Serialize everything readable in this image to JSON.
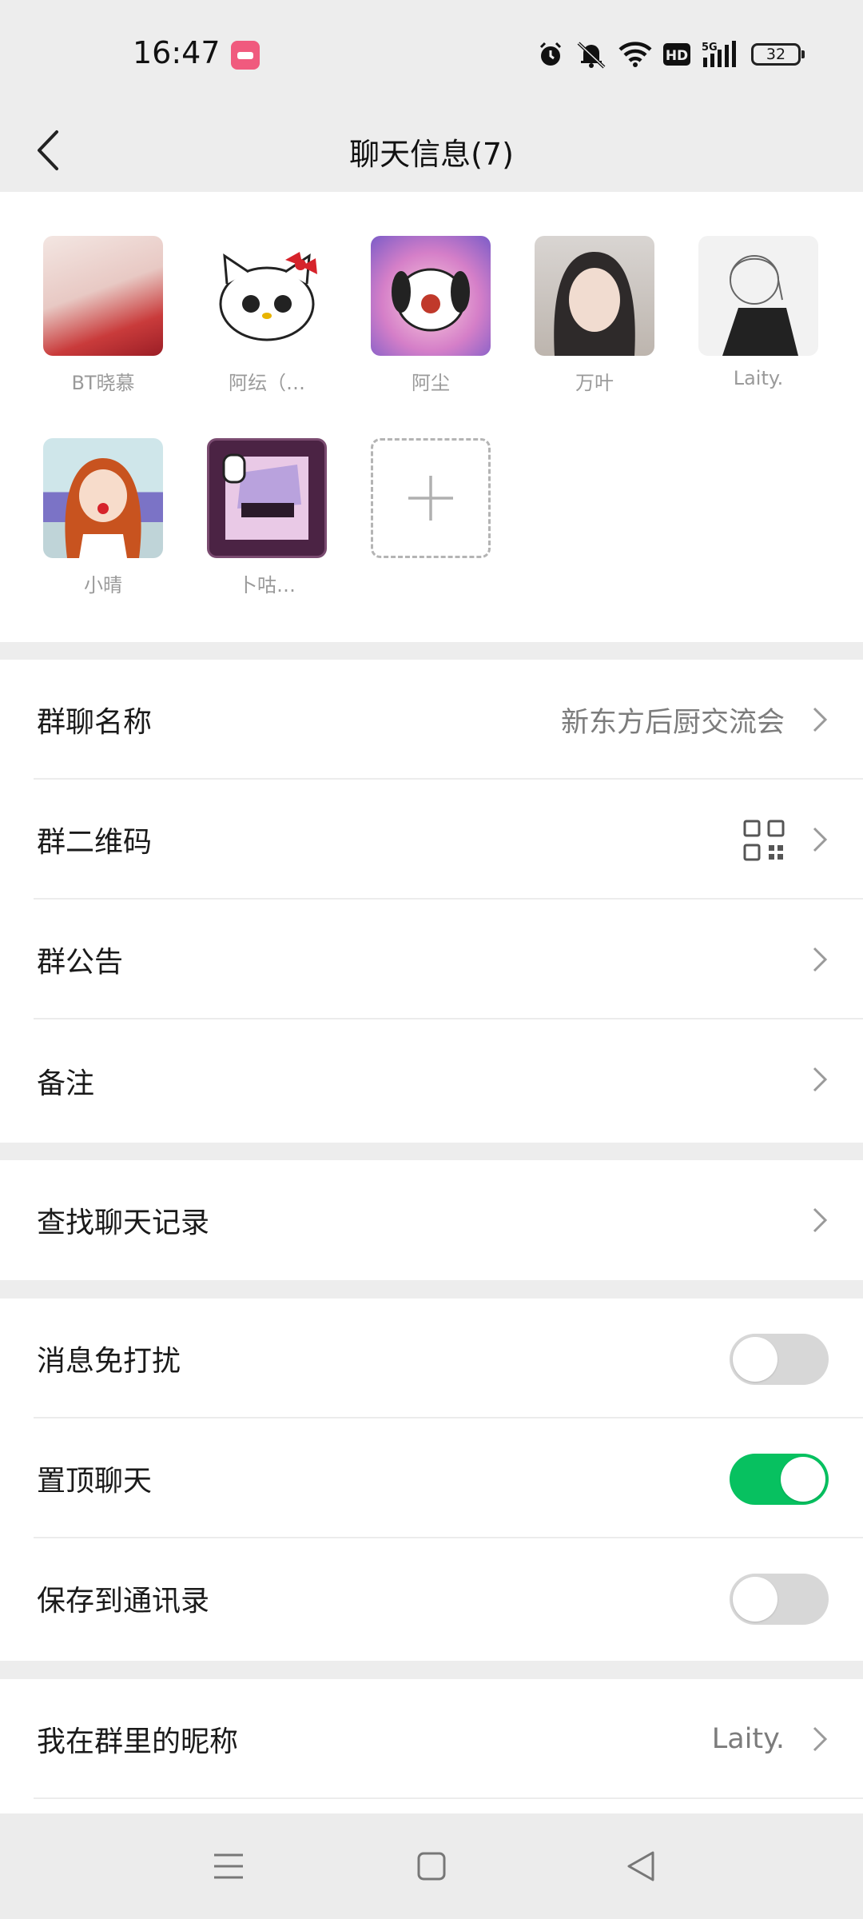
{
  "status": {
    "time": "16:47",
    "battery": "32",
    "hd_label": "HD",
    "net_label": "5G"
  },
  "header": {
    "title": "聊天信息(7)"
  },
  "members": [
    {
      "name": "BT晓慕",
      "avatar_color": "#e9b9b4"
    },
    {
      "name": "阿纭（…",
      "avatar_color": "#ffffff"
    },
    {
      "name": "阿尘",
      "avatar_color": "#c98fd0"
    },
    {
      "name": "万叶",
      "avatar_color": "#cfc6c0"
    },
    {
      "name": "Laity.",
      "avatar_color": "#e6e6e6"
    },
    {
      "name": "小晴",
      "avatar_color": "#8fa7d6"
    },
    {
      "name": "卜咕…",
      "avatar_color": "#6e3e66"
    }
  ],
  "rows": {
    "group_name": {
      "label": "群聊名称",
      "value": "新东方后厨交流会"
    },
    "group_qr": {
      "label": "群二维码"
    },
    "announcement": {
      "label": "群公告"
    },
    "remark": {
      "label": "备注"
    },
    "search_history": {
      "label": "查找聊天记录"
    },
    "mute": {
      "label": "消息免打扰",
      "on": false
    },
    "pin": {
      "label": "置顶聊天",
      "on": true
    },
    "save_contacts": {
      "label": "保存到通讯录",
      "on": false
    },
    "my_nickname": {
      "label": "我在群里的昵称",
      "value": "Laity."
    }
  },
  "colors": {
    "accent": "#07c160",
    "background": "#ededed"
  }
}
